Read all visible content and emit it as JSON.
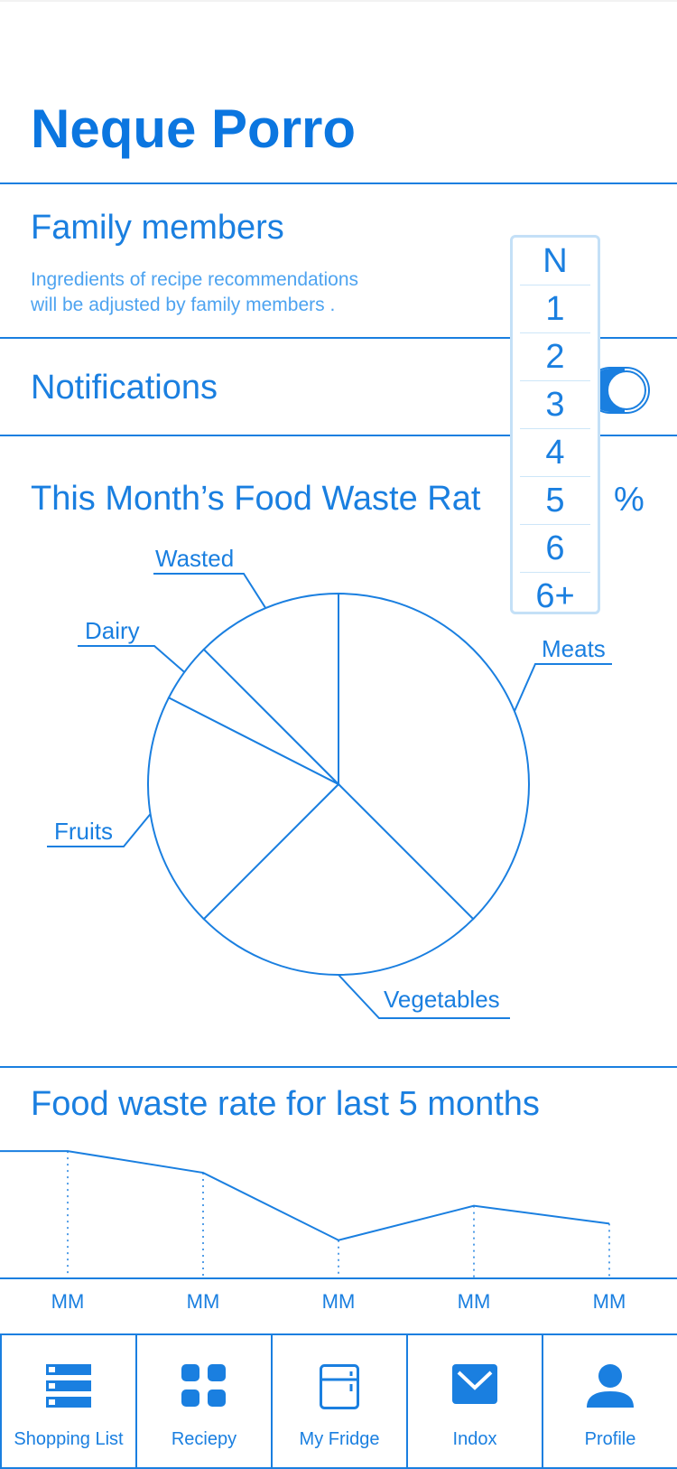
{
  "app": {
    "title": "Neque Porro"
  },
  "family": {
    "label": "Family members",
    "description_line1": "Ingredients of recipe recommendations",
    "description_line2": "will be adjusted by family members ."
  },
  "notifications": {
    "label": "Notifications",
    "enabled": true
  },
  "picker": {
    "options": [
      "N",
      "1",
      "2",
      "3",
      "4",
      "5",
      "6",
      "6+"
    ]
  },
  "waste_month": {
    "title": "This Month’s Food Waste Rat",
    "suffix": "%"
  },
  "trend": {
    "title": "Food waste rate for last 5 months"
  },
  "colors": {
    "primary": "#1a7fe0",
    "picker_border": "#c4e0f7"
  },
  "chart_data": [
    {
      "type": "pie",
      "title": "This Month’s Food Waste Rate",
      "categories": [
        "Meats",
        "Vegetables",
        "Fruits",
        "Dairy",
        "Wasted"
      ],
      "values": [
        37.5,
        25,
        20,
        5,
        12.5
      ]
    },
    {
      "type": "line",
      "title": "Food waste rate for last 5 months",
      "categories": [
        "MM",
        "MM",
        "MM",
        "MM",
        "MM"
      ],
      "values": [
        100,
        83,
        30,
        57,
        43
      ],
      "ylim": [
        0,
        110
      ]
    }
  ],
  "tabs": [
    {
      "label": "Shopping List",
      "icon": "list-icon"
    },
    {
      "label": "Reciepy",
      "icon": "grid-icon"
    },
    {
      "label": "My Fridge",
      "icon": "fridge-icon"
    },
    {
      "label": "Indox",
      "icon": "mail-icon"
    },
    {
      "label": "Profile",
      "icon": "person-icon"
    }
  ]
}
